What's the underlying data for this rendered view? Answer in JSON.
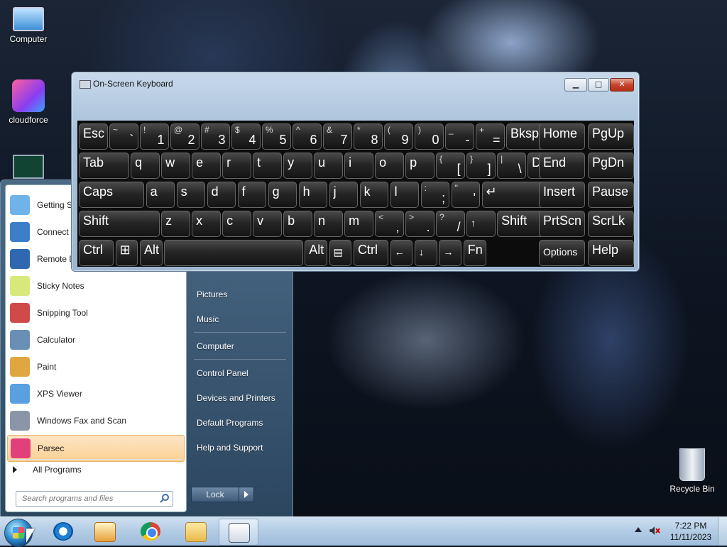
{
  "desktop": {
    "icons": [
      {
        "label": "Computer",
        "icon": "computer-icon"
      },
      {
        "label": "cloudforce",
        "icon": "cloudforce-icon"
      },
      {
        "label": "Recycle Bin",
        "icon": "recycle-bin-icon"
      }
    ]
  },
  "start_menu": {
    "programs": [
      {
        "label": "Getting S",
        "icon": "getting-started-icon",
        "color": "#6fb3e8"
      },
      {
        "label": "Connect t",
        "icon": "connect-projector-icon",
        "color": "#3c7fc8"
      },
      {
        "label": "Remote D",
        "icon": "remote-desktop-icon",
        "color": "#2f68b0"
      },
      {
        "label": "Sticky Notes",
        "icon": "sticky-notes-icon",
        "color": "#d8e87a"
      },
      {
        "label": "Snipping Tool",
        "icon": "snipping-tool-icon",
        "color": "#d04a4a"
      },
      {
        "label": "Calculator",
        "icon": "calculator-icon",
        "color": "#6a8fb5"
      },
      {
        "label": "Paint",
        "icon": "paint-icon",
        "color": "#e0a640"
      },
      {
        "label": "XPS Viewer",
        "icon": "xps-viewer-icon",
        "color": "#5aa0e0"
      },
      {
        "label": "Windows Fax and Scan",
        "icon": "fax-scan-icon",
        "color": "#8a96a8"
      },
      {
        "label": "Parsec",
        "icon": "parsec-icon",
        "color": "#e2407a",
        "highlighted": true
      }
    ],
    "all_programs": "All Programs",
    "search_placeholder": "Search programs and files",
    "right_links": [
      "Pictures",
      "Music",
      "Computer",
      "Control Panel",
      "Devices and Printers",
      "Default Programs",
      "Help and Support"
    ],
    "lock_label": "Lock"
  },
  "osk": {
    "title": "On-Screen Keyboard",
    "window_buttons": {
      "minimize": "▁",
      "maximize": "□",
      "close": "✕"
    },
    "rows": [
      [
        {
          "label": "Esc",
          "w": 1
        },
        {
          "shift": "~",
          "base": "`",
          "w": 1
        },
        {
          "shift": "!",
          "base": "1",
          "w": 1
        },
        {
          "shift": "@",
          "base": "2",
          "w": 1
        },
        {
          "shift": "#",
          "base": "3",
          "w": 1
        },
        {
          "shift": "$",
          "base": "4",
          "w": 1
        },
        {
          "shift": "%",
          "base": "5",
          "w": 1
        },
        {
          "shift": "^",
          "base": "6",
          "w": 1
        },
        {
          "shift": "&",
          "base": "7",
          "w": 1
        },
        {
          "shift": "*",
          "base": "8",
          "w": 1
        },
        {
          "shift": "(",
          "base": "9",
          "w": 1
        },
        {
          "shift": ")",
          "base": "0",
          "w": 1
        },
        {
          "shift": "_",
          "base": "-",
          "w": 1
        },
        {
          "shift": "+",
          "base": "=",
          "w": 1
        },
        {
          "label": "Bksp",
          "w": 1.65
        }
      ],
      [
        {
          "label": "Tab",
          "w": 1.7
        },
        {
          "label": "q",
          "w": 1
        },
        {
          "label": "w",
          "w": 1
        },
        {
          "label": "e",
          "w": 1
        },
        {
          "label": "r",
          "w": 1
        },
        {
          "label": "t",
          "w": 1
        },
        {
          "label": "y",
          "w": 1
        },
        {
          "label": "u",
          "w": 1
        },
        {
          "label": "i",
          "w": 1
        },
        {
          "label": "o",
          "w": 1
        },
        {
          "label": "p",
          "w": 1
        },
        {
          "shift": "{",
          "base": "[",
          "w": 1
        },
        {
          "shift": "}",
          "base": "]",
          "w": 1
        },
        {
          "shift": "|",
          "base": "\\",
          "w": 1
        },
        {
          "label": "Del",
          "w": 1
        }
      ],
      [
        {
          "label": "Caps",
          "w": 2.2
        },
        {
          "label": "a",
          "w": 1
        },
        {
          "label": "s",
          "w": 1
        },
        {
          "label": "d",
          "w": 1
        },
        {
          "label": "f",
          "w": 1
        },
        {
          "label": "g",
          "w": 1
        },
        {
          "label": "h",
          "w": 1
        },
        {
          "label": "j",
          "w": 1
        },
        {
          "label": "k",
          "w": 1
        },
        {
          "label": "l",
          "w": 1
        },
        {
          "shift": ":",
          "base": ";",
          "w": 1
        },
        {
          "shift": "\"",
          "base": "'",
          "w": 1
        },
        {
          "label": "↵",
          "w": 2.2,
          "enter": true
        }
      ],
      [
        {
          "label": "Shift",
          "w": 2.7
        },
        {
          "label": "z",
          "w": 1
        },
        {
          "label": "x",
          "w": 1
        },
        {
          "label": "c",
          "w": 1
        },
        {
          "label": "v",
          "w": 1
        },
        {
          "label": "b",
          "w": 1
        },
        {
          "label": "n",
          "w": 1
        },
        {
          "label": "m",
          "w": 1
        },
        {
          "shift": "<",
          "base": ",",
          "w": 1
        },
        {
          "shift": ">",
          "base": ".",
          "w": 1
        },
        {
          "shift": "?",
          "base": "/",
          "w": 1
        },
        {
          "label": "↑",
          "w": 1,
          "small": true
        },
        {
          "label": "Shift",
          "w": 1.65
        }
      ],
      [
        {
          "label": "Ctrl",
          "w": 1.2
        },
        {
          "label": "⊞",
          "w": 0.8,
          "icon": "windows-key-icon"
        },
        {
          "label": "Alt",
          "w": 0.8
        },
        {
          "label": "",
          "w": 4.6
        },
        {
          "label": "Alt",
          "w": 0.8
        },
        {
          "label": "▤",
          "w": 0.8,
          "small": true,
          "icon": "menu-key-icon"
        },
        {
          "label": "Ctrl",
          "w": 1.2
        },
        {
          "label": "←",
          "w": 0.8,
          "small": true
        },
        {
          "label": "↓",
          "w": 0.8,
          "small": true
        },
        {
          "label": "→",
          "w": 0.8,
          "small": true
        },
        {
          "label": "Fn",
          "w": 0.8
        }
      ]
    ],
    "nav_rows": [
      [
        {
          "label": "Home"
        },
        {
          "label": "PgUp"
        }
      ],
      [
        {
          "label": "End"
        },
        {
          "label": "PgDn"
        }
      ],
      [
        {
          "label": "Insert"
        },
        {
          "label": "Pause"
        }
      ],
      [
        {
          "label": "PrtScn"
        },
        {
          "label": "ScrLk"
        }
      ],
      [
        {
          "label": "Options",
          "small": true
        },
        {
          "label": "Help"
        }
      ]
    ]
  },
  "taskbar": {
    "apps": [
      {
        "name": "internet-explorer-icon",
        "active": false
      },
      {
        "name": "media-player-icon",
        "active": false
      },
      {
        "name": "chrome-icon",
        "active": false
      },
      {
        "name": "file-explorer-icon",
        "active": false
      },
      {
        "name": "on-screen-keyboard-icon",
        "active": true
      }
    ],
    "time": "7:22 PM",
    "date": "11/11/2023"
  }
}
